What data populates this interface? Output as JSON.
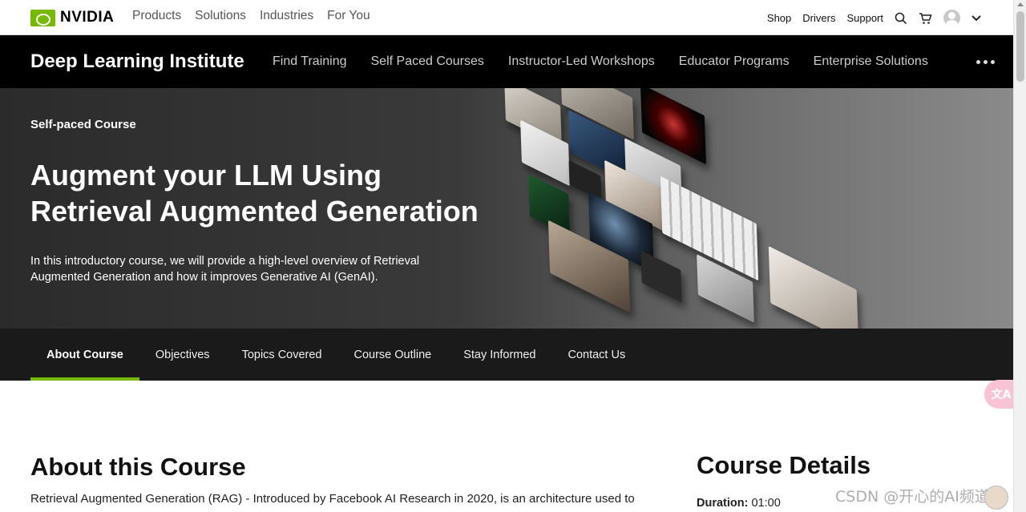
{
  "brand": {
    "name": "NVIDIA",
    "color": "#76b900"
  },
  "primary_nav": {
    "items": [
      "Products",
      "Solutions",
      "Industries",
      "For You"
    ]
  },
  "utility_nav": {
    "shop": "Shop",
    "drivers": "Drivers",
    "support": "Support"
  },
  "dli_nav": {
    "title": "Deep Learning Institute",
    "items": [
      "Find Training",
      "Self Paced Courses",
      "Instructor-Led Workshops",
      "Educator Programs",
      "Enterprise Solutions"
    ]
  },
  "hero": {
    "eyebrow": "Self-paced Course",
    "title": "Augment your LLM Using Retrieval Augmented Generation",
    "description": "In this introductory course, we will provide a high-level overview of Retrieval Augmented Generation and how it improves Generative AI (GenAI)."
  },
  "tabs": {
    "items": [
      "About Course",
      "Objectives",
      "Topics Covered",
      "Course Outline",
      "Stay Informed",
      "Contact Us"
    ],
    "active": "About Course"
  },
  "about": {
    "heading": "About this Course",
    "text": "Retrieval Augmented Generation (RAG) - Introduced by Facebook AI Research in 2020, is an architecture used to"
  },
  "details": {
    "heading": "Course Details",
    "duration_label": "Duration:",
    "duration_value": "01:00"
  },
  "translate_button": {
    "label": "文A"
  },
  "watermark": {
    "text": "CSDN @开心的AI频道"
  }
}
